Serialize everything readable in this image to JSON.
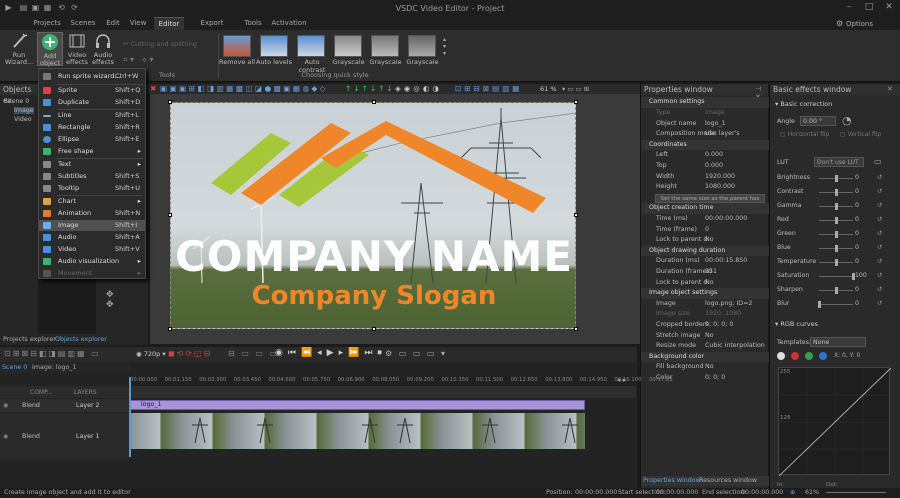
{
  "window": {
    "title": "VSDC Video Editor - Project"
  },
  "menu": {
    "tabs": [
      "Projects",
      "Scenes",
      "Edit",
      "View",
      "Editor",
      "Export project",
      "Tools",
      "Activation"
    ],
    "active": "Editor",
    "options_label": "Options"
  },
  "ribbon": {
    "run_wizard": "Run Wizard...",
    "add_object": "Add object",
    "video_effects": "Video effects",
    "audio_effects": "Audio effects",
    "cutting": "Cutting and splitting",
    "tools_group": "Tools",
    "quick_styles": [
      "Remove all",
      "Auto levels",
      "Auto contrast",
      "Grayscale",
      "Grayscale",
      "Grayscale"
    ],
    "quick_group": "Choosing quick style"
  },
  "add_menu": [
    {
      "label": "Run sprite wizard...",
      "shortcut": "Ctrl+W"
    },
    {
      "label": "Sprite",
      "shortcut": "Shift+Q"
    },
    {
      "label": "Duplicate",
      "shortcut": "Shift+D"
    },
    {
      "label": "Line",
      "shortcut": "Shift+L"
    },
    {
      "label": "Rectangle",
      "shortcut": "Shift+R"
    },
    {
      "label": "Ellipse",
      "shortcut": "Shift+E"
    },
    {
      "label": "Free shape",
      "shortcut": ""
    },
    {
      "label": "Text",
      "shortcut": ""
    },
    {
      "label": "Subtitles",
      "shortcut": "Shift+S"
    },
    {
      "label": "Tooltip",
      "shortcut": "Shift+U"
    },
    {
      "label": "Chart",
      "shortcut": ""
    },
    {
      "label": "Animation",
      "shortcut": "Shift+N"
    },
    {
      "label": "Image",
      "shortcut": "Shift+I"
    },
    {
      "label": "Audio",
      "shortcut": "Shift+A"
    },
    {
      "label": "Video",
      "shortcut": "Shift+V"
    },
    {
      "label": "Audio visualization",
      "shortcut": ""
    },
    {
      "label": "Movement",
      "shortcut": ""
    }
  ],
  "objects_panel": {
    "title": "Objects ex",
    "scene": "Scene 0",
    "items": [
      "Image",
      "Video"
    ]
  },
  "canvas": {
    "zoom": "61 %",
    "company_name": "COMPANY NAME",
    "company_slogan": "Company Slogan"
  },
  "properties": {
    "title": "Properties window",
    "common": "Common settings",
    "rows": [
      {
        "k": "Type",
        "v": "Image",
        "sec": false,
        "dim": true
      },
      {
        "k": "Object name",
        "v": "logo_1"
      },
      {
        "k": "Composition mode",
        "v": "Use layer's properties"
      },
      {
        "k": "Coordinates",
        "v": "",
        "sec": true
      },
      {
        "k": "Left",
        "v": "0.000"
      },
      {
        "k": "Top",
        "v": "0.000"
      },
      {
        "k": "Width",
        "v": "1920.000"
      },
      {
        "k": "Height",
        "v": "1080.000"
      },
      {
        "k": "",
        "v": "Set the same size as the parent has",
        "btn": true
      },
      {
        "k": "Object creation time",
        "v": "",
        "sec": true
      },
      {
        "k": "Time (ms)",
        "v": "00:00:00.000"
      },
      {
        "k": "Time (frame)",
        "v": "0"
      },
      {
        "k": "Lock to parent d",
        "v": "No"
      },
      {
        "k": "Object drawing duration",
        "v": "",
        "sec": true
      },
      {
        "k": "Duration (ms)",
        "v": "00:00:15.850"
      },
      {
        "k": "Duration (frames)",
        "v": "951"
      },
      {
        "k": "Lock to parent d",
        "v": "No"
      },
      {
        "k": "Image object settings",
        "v": "",
        "sec": true
      },
      {
        "k": "Image",
        "v": "logo.png; ID=2"
      },
      {
        "k": "Image size",
        "v": "1920; 1080",
        "dim": true
      },
      {
        "k": "Cropped borders",
        "v": "0; 0; 0; 0"
      },
      {
        "k": "Stretch image",
        "v": "No"
      },
      {
        "k": "Resize mode",
        "v": "Cubic interpolation"
      },
      {
        "k": "Background color",
        "v": "",
        "sec": true
      },
      {
        "k": "Fill background",
        "v": "No"
      },
      {
        "k": "Color",
        "v": "0; 0; 0"
      }
    ],
    "tabs": [
      "Properties window",
      "Resources window"
    ]
  },
  "basic_effects": {
    "title": "Basic effects window",
    "section": "Basic correction",
    "angle_label": "Angle",
    "angle_value": "0.00 °",
    "hflip": "Horizontal flip",
    "vflip": "Vertical flip",
    "lut_label": "LUT",
    "lut_value": "Don't use LUT",
    "sliders": [
      {
        "k": "Brightness",
        "v": "0",
        "pos": 0.5
      },
      {
        "k": "Contrast",
        "v": "0",
        "pos": 0.5
      },
      {
        "k": "Gamma",
        "v": "0",
        "pos": 0.5
      },
      {
        "k": "Red",
        "v": "0",
        "pos": 0.5
      },
      {
        "k": "Green",
        "v": "0",
        "pos": 0.5
      },
      {
        "k": "Blue",
        "v": "0",
        "pos": 0.5
      },
      {
        "k": "Temperature",
        "v": "0",
        "pos": 0.5
      },
      {
        "k": "Saturation",
        "v": "100",
        "pos": 1.0
      },
      {
        "k": "Sharpen",
        "v": "0",
        "pos": 0.5
      },
      {
        "k": "Blur",
        "v": "0",
        "pos": 0.0
      }
    ],
    "rgb_curves": "RGB curves",
    "templates_label": "Templates:",
    "templates_value": "None",
    "xy": "X: 0, Y: 0",
    "curve_labels": [
      "255",
      "128",
      "In:",
      "Out:"
    ]
  },
  "timeline": {
    "tabs": [
      "Projects explorer",
      "Objects explorer"
    ],
    "resolution": "720p",
    "scene_tabs": [
      "Scene 0",
      "Image: logo_1"
    ],
    "comp_label": "COMP...",
    "layers_label": "LAYERS",
    "ruler": [
      "00:00.000",
      "00:01.150",
      "00:02.300",
      "00:03.450",
      "00:04.600",
      "00:05.750",
      "00:06.900",
      "00:08.050",
      "00:09.200",
      "00:10.350",
      "00:11.500",
      "00:12.650",
      "00:13.800",
      "00:14.950",
      "00:16.100",
      "00:17.25"
    ],
    "tracks": [
      {
        "blend": "Blend",
        "layer": "Layer 2",
        "clip": "logo_1"
      },
      {
        "blend": "Blend",
        "layer": "Layer 1",
        "clip": ""
      }
    ]
  },
  "status": {
    "hint": "Create image object and add it to editor",
    "position_label": "Position:",
    "position": "00:00:00.000",
    "start_label": "Start selection:",
    "start": "00:00:00.000",
    "end_label": "End selection:",
    "end": "00:00:00.000",
    "zoom": "61%"
  }
}
